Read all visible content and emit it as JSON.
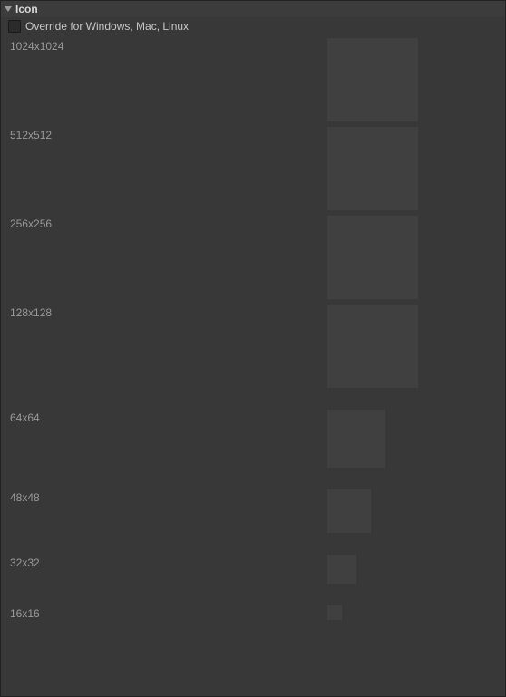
{
  "section": {
    "title": "Icon",
    "override": {
      "label": "Override for Windows, Mac, Linux",
      "checked": false
    },
    "sizes": [
      {
        "label": "1024x1024",
        "w": 100,
        "h": 92
      },
      {
        "label": "512x512",
        "w": 100,
        "h": 92
      },
      {
        "label": "256x256",
        "w": 100,
        "h": 92
      },
      {
        "label": "128x128",
        "w": 100,
        "h": 92
      },
      {
        "label": "64x64",
        "w": 64,
        "h": 64
      },
      {
        "label": "48x48",
        "w": 48,
        "h": 48
      },
      {
        "label": "32x32",
        "w": 32,
        "h": 32
      },
      {
        "label": "16x16",
        "w": 16,
        "h": 16
      }
    ]
  }
}
